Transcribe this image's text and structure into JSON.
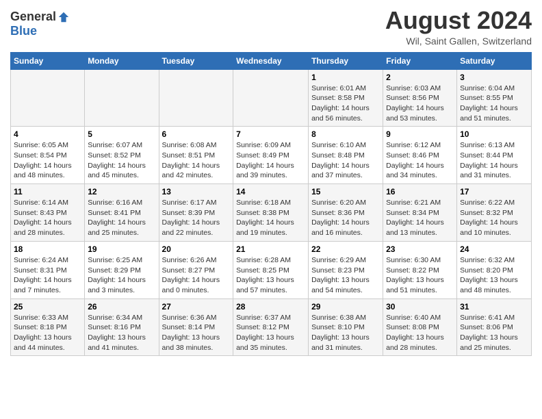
{
  "header": {
    "logo_general": "General",
    "logo_blue": "Blue",
    "main_title": "August 2024",
    "subtitle": "Wil, Saint Gallen, Switzerland"
  },
  "days_of_week": [
    "Sunday",
    "Monday",
    "Tuesday",
    "Wednesday",
    "Thursday",
    "Friday",
    "Saturday"
  ],
  "weeks": [
    {
      "days": [
        {
          "num": "",
          "info": ""
        },
        {
          "num": "",
          "info": ""
        },
        {
          "num": "",
          "info": ""
        },
        {
          "num": "",
          "info": ""
        },
        {
          "num": "1",
          "info": "Sunrise: 6:01 AM\nSunset: 8:58 PM\nDaylight: 14 hours and 56 minutes."
        },
        {
          "num": "2",
          "info": "Sunrise: 6:03 AM\nSunset: 8:56 PM\nDaylight: 14 hours and 53 minutes."
        },
        {
          "num": "3",
          "info": "Sunrise: 6:04 AM\nSunset: 8:55 PM\nDaylight: 14 hours and 51 minutes."
        }
      ]
    },
    {
      "days": [
        {
          "num": "4",
          "info": "Sunrise: 6:05 AM\nSunset: 8:54 PM\nDaylight: 14 hours and 48 minutes."
        },
        {
          "num": "5",
          "info": "Sunrise: 6:07 AM\nSunset: 8:52 PM\nDaylight: 14 hours and 45 minutes."
        },
        {
          "num": "6",
          "info": "Sunrise: 6:08 AM\nSunset: 8:51 PM\nDaylight: 14 hours and 42 minutes."
        },
        {
          "num": "7",
          "info": "Sunrise: 6:09 AM\nSunset: 8:49 PM\nDaylight: 14 hours and 39 minutes."
        },
        {
          "num": "8",
          "info": "Sunrise: 6:10 AM\nSunset: 8:48 PM\nDaylight: 14 hours and 37 minutes."
        },
        {
          "num": "9",
          "info": "Sunrise: 6:12 AM\nSunset: 8:46 PM\nDaylight: 14 hours and 34 minutes."
        },
        {
          "num": "10",
          "info": "Sunrise: 6:13 AM\nSunset: 8:44 PM\nDaylight: 14 hours and 31 minutes."
        }
      ]
    },
    {
      "days": [
        {
          "num": "11",
          "info": "Sunrise: 6:14 AM\nSunset: 8:43 PM\nDaylight: 14 hours and 28 minutes."
        },
        {
          "num": "12",
          "info": "Sunrise: 6:16 AM\nSunset: 8:41 PM\nDaylight: 14 hours and 25 minutes."
        },
        {
          "num": "13",
          "info": "Sunrise: 6:17 AM\nSunset: 8:39 PM\nDaylight: 14 hours and 22 minutes."
        },
        {
          "num": "14",
          "info": "Sunrise: 6:18 AM\nSunset: 8:38 PM\nDaylight: 14 hours and 19 minutes."
        },
        {
          "num": "15",
          "info": "Sunrise: 6:20 AM\nSunset: 8:36 PM\nDaylight: 14 hours and 16 minutes."
        },
        {
          "num": "16",
          "info": "Sunrise: 6:21 AM\nSunset: 8:34 PM\nDaylight: 14 hours and 13 minutes."
        },
        {
          "num": "17",
          "info": "Sunrise: 6:22 AM\nSunset: 8:32 PM\nDaylight: 14 hours and 10 minutes."
        }
      ]
    },
    {
      "days": [
        {
          "num": "18",
          "info": "Sunrise: 6:24 AM\nSunset: 8:31 PM\nDaylight: 14 hours and 7 minutes."
        },
        {
          "num": "19",
          "info": "Sunrise: 6:25 AM\nSunset: 8:29 PM\nDaylight: 14 hours and 3 minutes."
        },
        {
          "num": "20",
          "info": "Sunrise: 6:26 AM\nSunset: 8:27 PM\nDaylight: 14 hours and 0 minutes."
        },
        {
          "num": "21",
          "info": "Sunrise: 6:28 AM\nSunset: 8:25 PM\nDaylight: 13 hours and 57 minutes."
        },
        {
          "num": "22",
          "info": "Sunrise: 6:29 AM\nSunset: 8:23 PM\nDaylight: 13 hours and 54 minutes."
        },
        {
          "num": "23",
          "info": "Sunrise: 6:30 AM\nSunset: 8:22 PM\nDaylight: 13 hours and 51 minutes."
        },
        {
          "num": "24",
          "info": "Sunrise: 6:32 AM\nSunset: 8:20 PM\nDaylight: 13 hours and 48 minutes."
        }
      ]
    },
    {
      "days": [
        {
          "num": "25",
          "info": "Sunrise: 6:33 AM\nSunset: 8:18 PM\nDaylight: 13 hours and 44 minutes."
        },
        {
          "num": "26",
          "info": "Sunrise: 6:34 AM\nSunset: 8:16 PM\nDaylight: 13 hours and 41 minutes."
        },
        {
          "num": "27",
          "info": "Sunrise: 6:36 AM\nSunset: 8:14 PM\nDaylight: 13 hours and 38 minutes."
        },
        {
          "num": "28",
          "info": "Sunrise: 6:37 AM\nSunset: 8:12 PM\nDaylight: 13 hours and 35 minutes."
        },
        {
          "num": "29",
          "info": "Sunrise: 6:38 AM\nSunset: 8:10 PM\nDaylight: 13 hours and 31 minutes."
        },
        {
          "num": "30",
          "info": "Sunrise: 6:40 AM\nSunset: 8:08 PM\nDaylight: 13 hours and 28 minutes."
        },
        {
          "num": "31",
          "info": "Sunrise: 6:41 AM\nSunset: 8:06 PM\nDaylight: 13 hours and 25 minutes."
        }
      ]
    }
  ]
}
